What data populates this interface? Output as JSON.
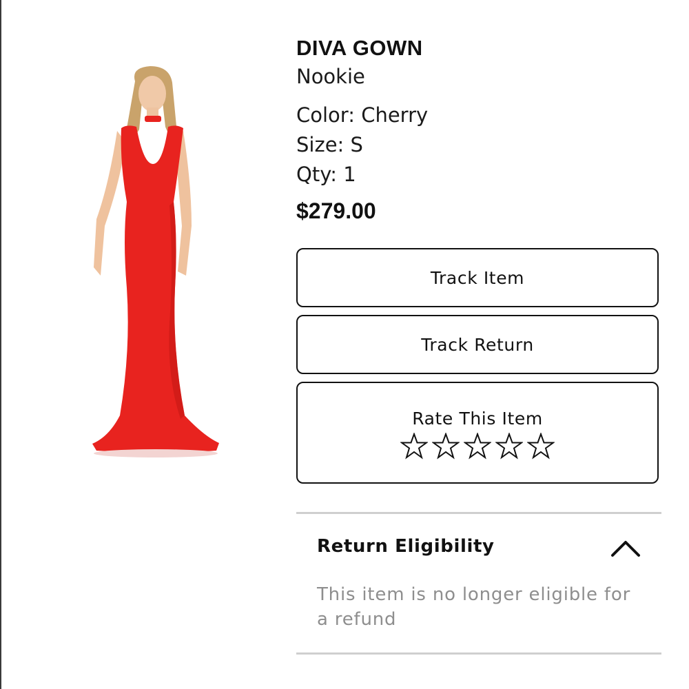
{
  "product": {
    "title": "DIVA GOWN",
    "brand": "Nookie",
    "color_text": "Color: Cherry",
    "size_text": "Size: S",
    "qty_text": "Qty: 1",
    "price": "$279.00",
    "image_icon": "red-gown-photo",
    "image_color": "#e8231f"
  },
  "actions": {
    "track_item_label": "Track Item",
    "track_return_label": "Track Return",
    "rate_label": "Rate This Item",
    "rating": 0,
    "rating_max": 5,
    "star_icon": "star-outline-icon"
  },
  "return_section": {
    "title": "Return Eligibility",
    "body": "This item is no longer eligible for a refund",
    "toggle_icon": "chevron-up-icon",
    "expanded": true
  }
}
